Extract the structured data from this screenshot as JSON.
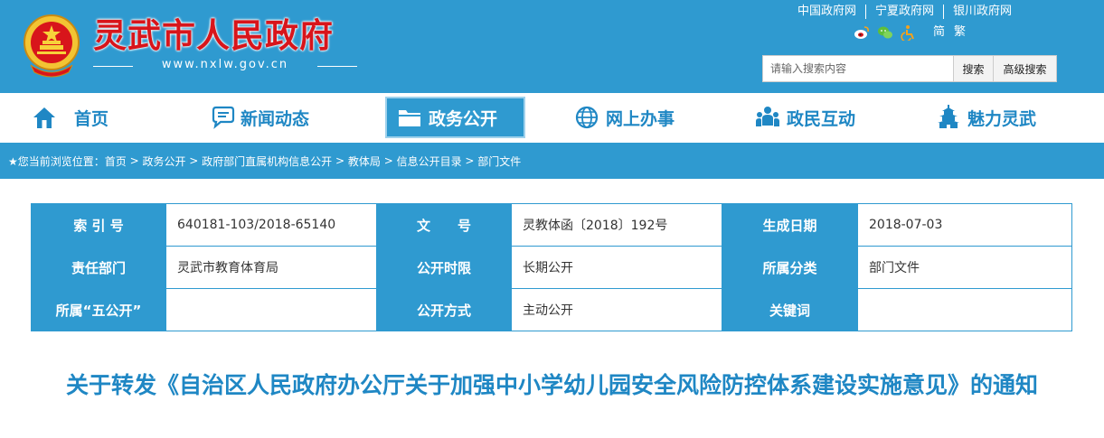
{
  "header": {
    "site_title": "灵武市人民政府",
    "site_url": "www.nxlw.gov.cn",
    "top_links": [
      "中国政府网",
      "宁夏政府网",
      "银川政府网"
    ],
    "lang_simplified": "简",
    "lang_traditional": "繁",
    "search": {
      "placeholder": "请输入搜索内容",
      "button": "搜索",
      "advanced": "高级搜索"
    },
    "colors": {
      "primary": "#2f9ad0",
      "title_red": "#d8151b"
    }
  },
  "nav": {
    "items": [
      {
        "label": "首页",
        "icon": "home-icon"
      },
      {
        "label": "新闻动态",
        "icon": "chat-bubble-icon"
      },
      {
        "label": "政务公开",
        "icon": "folder-icon",
        "active": true
      },
      {
        "label": "网上办事",
        "icon": "globe-icon"
      },
      {
        "label": "政民互动",
        "icon": "people-icon"
      },
      {
        "label": "魅力灵武",
        "icon": "pagoda-icon"
      }
    ]
  },
  "breadcrumb": {
    "prefix": "★您当前浏览位置：",
    "items": [
      "首页",
      "政务公开",
      "政府部门直属机构信息公开",
      "教体局",
      "信息公开目录",
      "部门文件"
    ],
    "separator": " > "
  },
  "info": {
    "rows": [
      [
        {
          "key": "索 引 号",
          "value": "640181-103/2018-65140"
        },
        {
          "key": "文　　号",
          "value": "灵教体函〔2018〕192号"
        },
        {
          "key": "生成日期",
          "value": "2018-07-03"
        }
      ],
      [
        {
          "key": "责任部门",
          "value": "灵武市教育体育局"
        },
        {
          "key": "公开时限",
          "value": "长期公开"
        },
        {
          "key": "所属分类",
          "value": "部门文件"
        }
      ],
      [
        {
          "key": "所属“五公开”",
          "value": ""
        },
        {
          "key": "公开方式",
          "value": "主动公开"
        },
        {
          "key": "关键词",
          "value": ""
        }
      ]
    ]
  },
  "document": {
    "title": "关于转发《自治区人民政府办公厅关于加强中小学幼儿园安全风险防控体系建设实施意见》的通知"
  }
}
